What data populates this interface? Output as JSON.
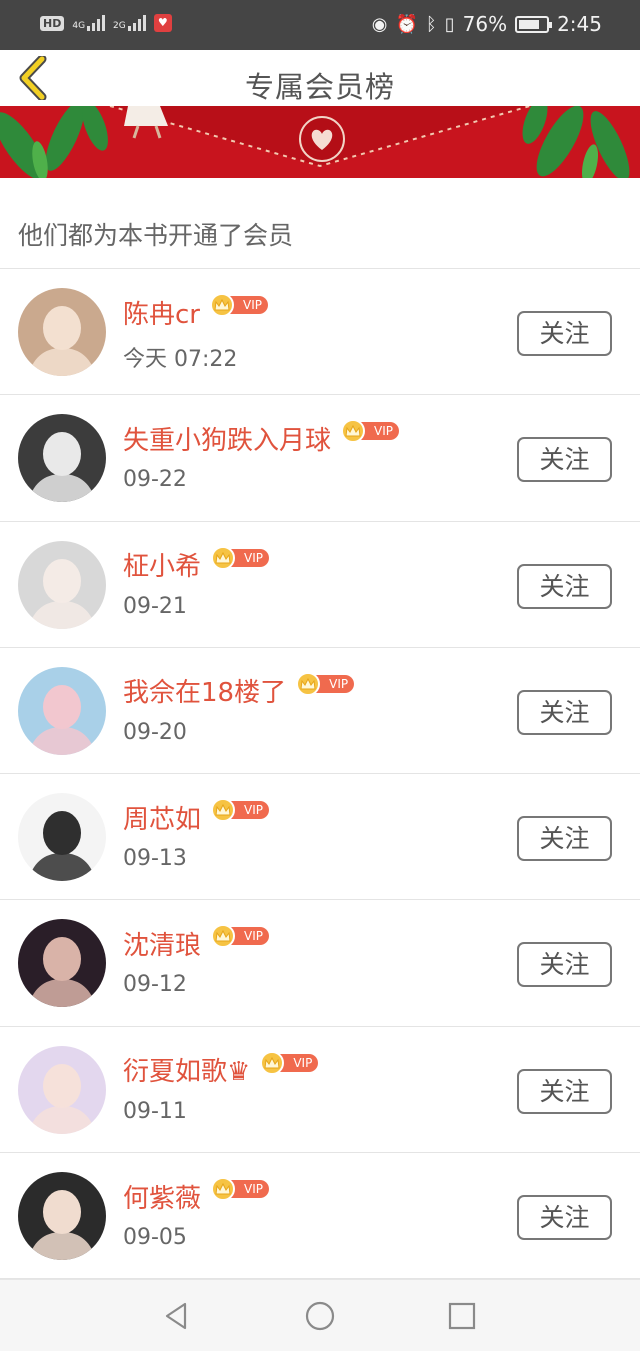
{
  "status_bar": {
    "hd": "HD",
    "net1": "4G",
    "net2": "2G",
    "battery_percent": "76%",
    "time": "2:45",
    "battery_level": 0.76
  },
  "header": {
    "title": "专属会员榜"
  },
  "subtitle": "他们都为本书开通了会员",
  "vip_label": "VIP",
  "follow_label": "关注",
  "members": [
    {
      "name": "陈冉cr",
      "date": "今天 07:22",
      "avatar_bg": "#caa98e",
      "avatar_fg": "#f3e0d0"
    },
    {
      "name": "失重小狗跌入月球",
      "date": "09-22",
      "avatar_bg": "#3c3c3c",
      "avatar_fg": "#e9e9e9"
    },
    {
      "name": "柾小希",
      "date": "09-21",
      "avatar_bg": "#d8d8d8",
      "avatar_fg": "#f4ebe6"
    },
    {
      "name": "我佘在18楼了",
      "date": "09-20",
      "avatar_bg": "#a9d0e8",
      "avatar_fg": "#f2c7cf"
    },
    {
      "name": "周芯如",
      "date": "09-13",
      "avatar_bg": "#f4f4f4",
      "avatar_fg": "#2f2f2f"
    },
    {
      "name": "沈清琅",
      "date": "09-12",
      "avatar_bg": "#2a1e28",
      "avatar_fg": "#d9b3a8"
    },
    {
      "name": "衍夏如歌♛",
      "date": "09-11",
      "avatar_bg": "#e3d7ee",
      "avatar_fg": "#f6e1da"
    },
    {
      "name": "何紫薇",
      "date": "09-05",
      "avatar_bg": "#2b2b2b",
      "avatar_fg": "#f0dccf"
    }
  ],
  "colors": {
    "accent_name": "#e0533d",
    "vip_pill": "#f06a4e",
    "crown": "#f6c343",
    "banner_red": "#c8141e",
    "back_arrow": "#f2d024"
  },
  "icons": {
    "back": "chevron-left-icon",
    "nav_back": "triangle-back-icon",
    "nav_home": "circle-home-icon",
    "nav_recent": "square-recent-icon"
  }
}
